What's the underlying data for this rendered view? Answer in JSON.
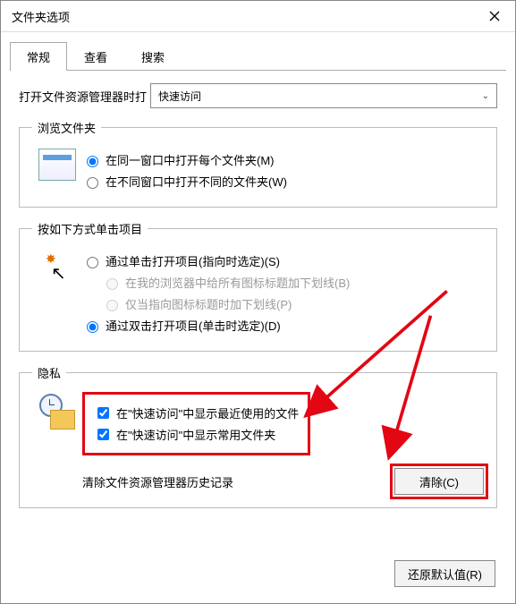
{
  "window": {
    "title": "文件夹选项"
  },
  "tabs": {
    "general": "常规",
    "view": "查看",
    "search": "搜索"
  },
  "open_in": {
    "label": "打开文件资源管理器时打",
    "value": "快速访问"
  },
  "browse": {
    "legend": "浏览文件夹",
    "opt_same": "在同一窗口中打开每个文件夹(M)",
    "opt_new": "在不同窗口中打开不同的文件夹(W)"
  },
  "click": {
    "legend": "按如下方式单击项目",
    "opt_single": "通过单击打开项目(指向时选定)(S)",
    "opt_under_all": "在我的浏览器中给所有图标标题加下划线(B)",
    "opt_under_point": "仅当指向图标标题时加下划线(P)",
    "opt_double": "通过双击打开项目(单击时选定)(D)"
  },
  "privacy": {
    "legend": "隐私",
    "chk_recent": "在\"快速访问\"中显示最近使用的文件",
    "chk_frequent": "在\"快速访问\"中显示常用文件夹",
    "clear_label": "清除文件资源管理器历史记录",
    "clear_btn": "清除(C)"
  },
  "footer": {
    "restore": "还原默认值(R)"
  }
}
